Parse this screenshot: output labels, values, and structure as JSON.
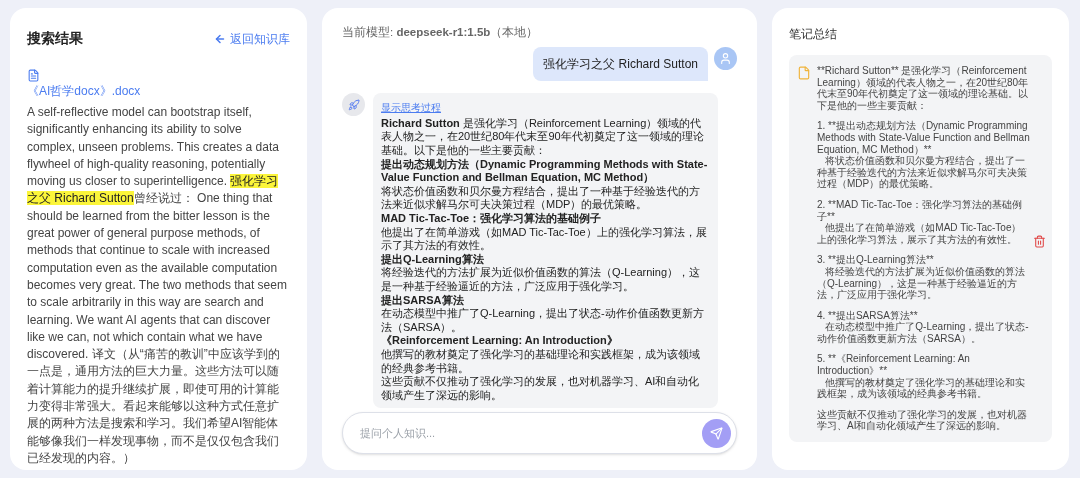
{
  "search_panel": {
    "title": "搜索结果",
    "back_link": "返回知识库",
    "document": {
      "name": "《AI哲学docx》.docx"
    },
    "excerpt": [
      {
        "text": "A self-reflective model can bootstrap itself, significantly enhancing its ability to solve complex, unseen problems. This creates a data flywheel of high-quality reasoning, potentially moving us closer to superintelligence. ",
        "highlighted": false
      },
      {
        "text": "强化学习之父 Richard Sutton",
        "highlighted": true
      },
      {
        "text": "曾经说过：  One thing that should be learned from the bitter lesson is the great power of general purpose methods, of methods that continue to scale with increased computation even as the available computation becomes very great. The two methods that seem to scale arbitrarily in this way are search and learning. We want AI agents that can discover like we can, not which contain what we have discovered. 译文（从“痛苦的教训”中应该学到的一点是，通用方法的巨大力量。这些方法可以随着计算能力的提升继续扩展，即使可用的计算能力变得非常强大。看起来能够以这种方式任意扩展的两种方法是搜索和学习。我们希望AI智能体能够像我们一样发现事物，而不是仅仅包含我们已经发现的内容。）",
        "highlighted": false
      }
    ]
  },
  "chat": {
    "model_label": "当前模型: **deepseek-r1:1.5b**（本地）",
    "messages": [
      {
        "kind": "user",
        "text": "强化学习之父 Richard Sutton"
      },
      {
        "kind": "assistant",
        "toggle": "显示思考过程",
        "blocks": [
          {
            "kind": "text",
            "text": "**Richard Sutton** 是强化学习（Reinforcement Learning）领域的代表人物之一，在20世纪80年代末至90年代初奠定了这一领域的理论基础。以下是他的一些主要贡献："
          },
          {
            "kind": "heading",
            "text": "提出动态规划方法（Dynamic Programming Methods with State-Value Function and Bellman Equation, MC Method）"
          },
          {
            "kind": "text",
            "text": "将状态价值函数和贝尔曼方程结合，提出了一种基于经验迭代的方法来近似求解马尔可夫决策过程（MDP）的最优策略。"
          },
          {
            "kind": "heading",
            "text": "MAD Tic-Tac-Toe：强化学习算法的基础例子"
          },
          {
            "kind": "text",
            "text": "他提出了在简单游戏（如MAD Tic-Tac-Toe）上的强化学习算法，展示了其方法的有效性。"
          },
          {
            "kind": "heading",
            "text": "提出Q-Learning算法"
          },
          {
            "kind": "text",
            "text": "将经验迭代的方法扩展为近似价值函数的算法（Q-Learning），这是一种基于经验逼近的方法，广泛应用于强化学习。"
          },
          {
            "kind": "heading",
            "text": "提出SARSA算法"
          },
          {
            "kind": "text",
            "text": "在动态模型中推广了Q-Learning，提出了状态-动作价值函数更新方法（SARSA）。"
          },
          {
            "kind": "heading",
            "text": "《Reinforcement Learning: An Introduction》"
          },
          {
            "kind": "text",
            "text": "他撰写的教材奠定了强化学习的基础理论和实践框架，成为该领域的经典参考书籍。"
          },
          {
            "kind": "text",
            "text": "这些贡献不仅推动了强化学习的发展，也对机器学习、AI和自动化领域产生了深远的影响。"
          }
        ]
      }
    ],
    "input": {
      "placeholder": "提问个人知识..."
    }
  },
  "notes": {
    "title": "笔记总结",
    "items": [
      {
        "paragraphs": [
          "**Richard Sutton** 是强化学习（Reinforcement Learning）领域的代表人物之一，在20世纪80年代末至90年代初奠定了这一领域的理论基础。以下是他的一些主要贡献：",
          "1. **提出动态规划方法（Dynamic Programming Methods with State-Value Function and Bellman Equation, MC Method）**\n   将状态价值函数和贝尔曼方程结合，提出了一种基于经验迭代的方法来近似求解马尔可夫决策过程（MDP）的最优策略。",
          "2. **MAD Tic-Tac-Toe：强化学习算法的基础例子**\n   他提出了在简单游戏（如MAD Tic-Tac-Toe）上的强化学习算法，展示了其方法的有效性。",
          "3. **提出Q-Learning算法**\n   将经验迭代的方法扩展为近似价值函数的算法（Q-Learning），这是一种基于经验逼近的方法，广泛应用于强化学习。",
          "4. **提出SARSA算法**\n   在动态模型中推广了Q-Learning，提出了状态-动作价值函数更新方法（SARSA）。",
          "5. **《Reinforcement Learning: An Introduction》**\n   他撰写的教材奠定了强化学习的基础理论和实践框架，成为该领域的经典参考书籍。",
          "这些贡献不仅推动了强化学习的发展，也对机器学习、AI和自动化领域产生了深远的影响。"
        ]
      }
    ]
  }
}
